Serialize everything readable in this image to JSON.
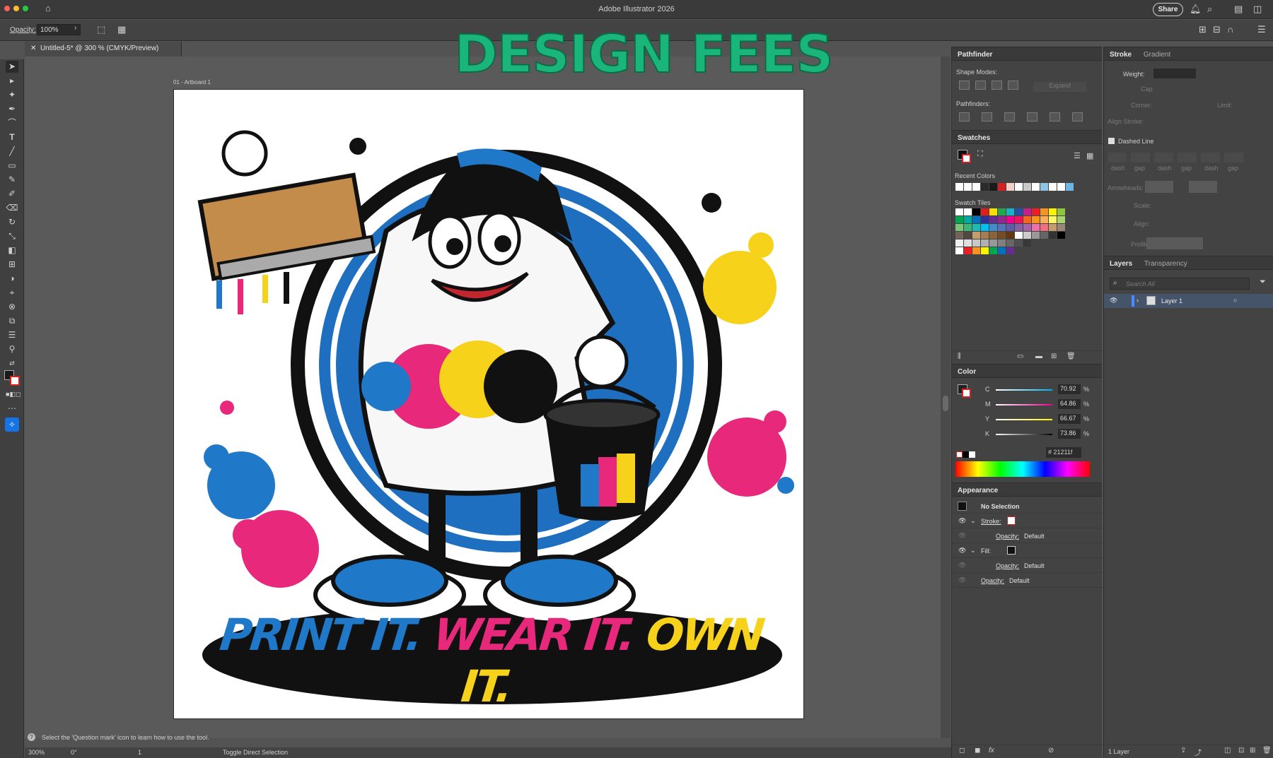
{
  "app": {
    "title": "Adobe Illustrator 2026",
    "share_label": "Share"
  },
  "control": {
    "opacity_label": "Opacity:",
    "opacity_value": "100%"
  },
  "document": {
    "tab_title": "Untitled-5* @ 300 % (CMYK/Preview)",
    "artboard_label": "01 - Artboard 1"
  },
  "overlay": {
    "title": "DESIGN FEES"
  },
  "artwork": {
    "slogan": [
      {
        "text": "PRINT IT.",
        "color": "#1f78c8"
      },
      {
        "text": "WEAR IT.",
        "color": "#e8287a"
      },
      {
        "text": "OWN IT.",
        "color": "#f6d21a"
      }
    ]
  },
  "status": {
    "hint": "Select the 'Question mark' icon to learn how to use the tool.",
    "zoom": "300%",
    "rotation": "0°",
    "artboard_number": "1",
    "mode": "Toggle Direct Selection"
  },
  "pathfinder": {
    "title": "Pathfinder",
    "shape_modes_label": "Shape Modes:",
    "pathfinders_label": "Pathfinders:",
    "expand_label": "Expand"
  },
  "swatches": {
    "title": "Swatches",
    "recent_label": "Recent Colors",
    "tiles_label": "Swatch Tiles",
    "recent": [
      "#ffffff",
      "#ffffff",
      "#ffffff",
      "#2a2a2a",
      "#1a1a1a",
      "#d32020",
      "#f4cfc8",
      "#ffffff",
      "#c9c9c9",
      "#ffffff",
      "#8ec5e4",
      "#ffffff",
      "#ffffff",
      "#6cb5e6"
    ],
    "tiles": [
      [
        "#ffffff",
        "#ffffff",
        "#000000",
        "#e21b1b",
        "#f7e000",
        "#21a84a",
        "#17b3c6",
        "#2450a8",
        "#c4208a",
        "#ee1c25",
        "#f7941d",
        "#fff200",
        "#8dc63f"
      ],
      [
        "#00a651",
        "#00a99d",
        "#0072bc",
        "#2e3192",
        "#662d91",
        "#92278f",
        "#ec008c",
        "#ed145b",
        "#f26522",
        "#f7941d",
        "#fbaf5d",
        "#fff568",
        "#acd373"
      ],
      [
        "#7cc576",
        "#3bb878",
        "#1abbb4",
        "#00bff3",
        "#438ccb",
        "#5574b9",
        "#605ca8",
        "#855fa8",
        "#a763a8",
        "#f06ea9",
        "#f26d7d",
        "#c69c6d",
        "#998675"
      ],
      [
        "#736357",
        "#534741",
        "#c69c6d",
        "#a67c52",
        "#8c6239",
        "#754c24",
        "#603913",
        "#ffffff",
        "#cccccc",
        "#999999",
        "#666666",
        "#333333",
        "#000000"
      ],
      [
        "#f0f0f0",
        "#e0e0e0",
        "#c8c8c8",
        "#b0b0b0",
        "#989898",
        "#808080",
        "#686868",
        "#505050",
        "#383838"
      ],
      [
        "#ffffff",
        "#ee1c25",
        "#f7941d",
        "#fff200",
        "#00a651",
        "#0072bc",
        "#662d91"
      ]
    ]
  },
  "color": {
    "title": "Color",
    "c_label": "C",
    "m_label": "M",
    "y_label": "Y",
    "k_label": "K",
    "c": "70.92",
    "m": "64.86",
    "y": "66.67",
    "k": "73.86",
    "pct": "%",
    "hex": "21211f",
    "hash": "#"
  },
  "appearance": {
    "title": "Appearance",
    "no_selection": "No Selection",
    "stroke_label": "Stroke:",
    "fill_label": "Fill:",
    "opacity_label": "Opacity:",
    "default_label": "Default"
  },
  "stroke": {
    "tab_stroke": "Stroke",
    "tab_gradient": "Gradient",
    "weight_label": "Weight:",
    "cap_label": "Cap:",
    "corner_label": "Corner:",
    "limit_label": "Limit:",
    "align_label": "Align Stroke:",
    "dashed_label": "Dashed Line",
    "dash_labels": [
      "dash",
      "gap",
      "dash",
      "gap",
      "dash",
      "gap"
    ],
    "arrowheads_label": "Arrowheads:",
    "scale_label": "Scale:",
    "align2_label": "Align:",
    "profile_label": "Profile:"
  },
  "layers": {
    "tab_layers": "Layers",
    "tab_transparency": "Transparency",
    "search_placeholder": "Search All",
    "layer_name": "Layer 1",
    "count": "1 Layer"
  }
}
